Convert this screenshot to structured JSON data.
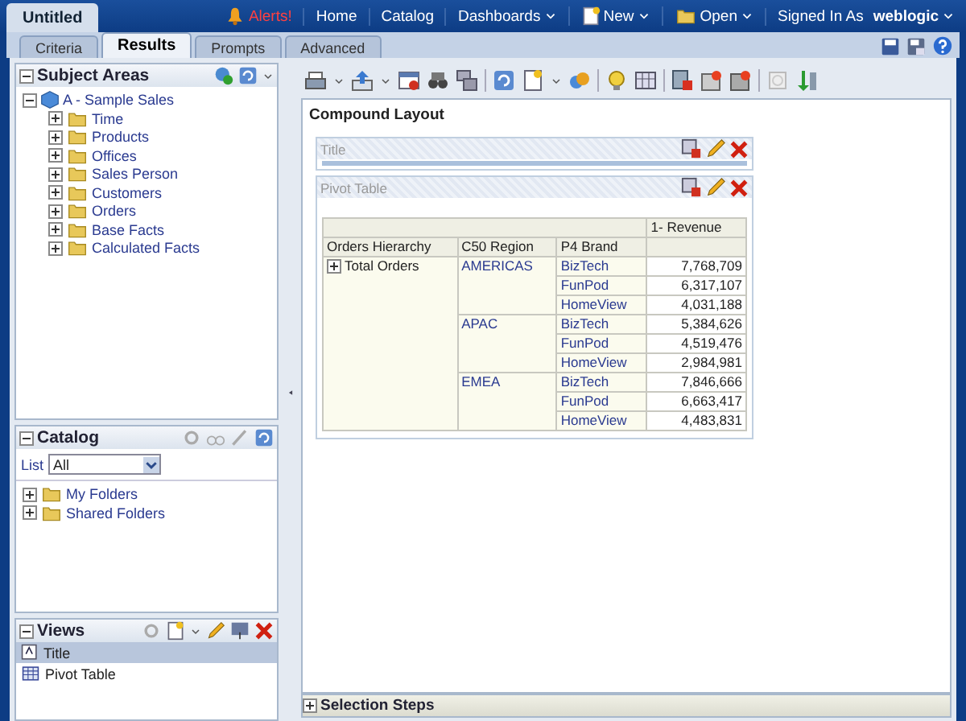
{
  "header": {
    "doc_title": "Untitled",
    "alerts": "Alerts!",
    "nav": [
      {
        "label": "Home",
        "menu": false
      },
      {
        "label": "Catalog",
        "menu": false
      },
      {
        "label": "Dashboards",
        "menu": true
      },
      {
        "label": "New",
        "menu": true
      },
      {
        "label": "Open",
        "menu": true
      }
    ],
    "signed_in_label": "Signed In As",
    "user": "weblogic"
  },
  "tabs": [
    {
      "label": "Criteria",
      "selected": false
    },
    {
      "label": "Results",
      "selected": true
    },
    {
      "label": "Prompts",
      "selected": false
    },
    {
      "label": "Advanced",
      "selected": false
    }
  ],
  "subject_areas": {
    "title": "Subject Areas",
    "root": {
      "label": "A - Sample Sales",
      "expanded": true,
      "children": [
        {
          "label": "Time",
          "expanded": false
        },
        {
          "label": "Products",
          "expanded": false
        },
        {
          "label": "Offices",
          "expanded": false
        },
        {
          "label": "Sales Person",
          "expanded": false
        },
        {
          "label": "Customers",
          "expanded": false
        },
        {
          "label": "Orders",
          "expanded": false
        },
        {
          "label": "Base Facts",
          "expanded": false
        },
        {
          "label": "Calculated Facts",
          "expanded": false
        }
      ]
    }
  },
  "catalog": {
    "title": "Catalog",
    "list_label": "List",
    "list_value": "All",
    "items": [
      {
        "label": "My Folders",
        "expanded": false
      },
      {
        "label": "Shared Folders",
        "expanded": false
      }
    ]
  },
  "views": {
    "title": "Views",
    "items": [
      {
        "label": "Title",
        "kind": "title",
        "selected": true
      },
      {
        "label": "Pivot Table",
        "kind": "pivot",
        "selected": false
      }
    ]
  },
  "compound_layout": {
    "title": "Compound Layout",
    "views": [
      {
        "title": "Title",
        "kind": "title"
      },
      {
        "title": "Pivot Table",
        "kind": "pivot"
      }
    ]
  },
  "pivot": {
    "measure": "1- Revenue",
    "columns": [
      "Orders Hierarchy",
      "C50 Region",
      "P4 Brand"
    ],
    "hierarchy": "Total Orders",
    "hierarchy_expanded": false,
    "regions": [
      {
        "name": "AMERICAS",
        "rows": [
          {
            "brand": "BizTech",
            "value": "7,768,709"
          },
          {
            "brand": "FunPod",
            "value": "6,317,107"
          },
          {
            "brand": "HomeView",
            "value": "4,031,188"
          }
        ]
      },
      {
        "name": "APAC",
        "rows": [
          {
            "brand": "BizTech",
            "value": "5,384,626"
          },
          {
            "brand": "FunPod",
            "value": "4,519,476"
          },
          {
            "brand": "HomeView",
            "value": "2,984,981"
          }
        ]
      },
      {
        "name": "EMEA",
        "rows": [
          {
            "brand": "BizTech",
            "value": "7,846,666"
          },
          {
            "brand": "FunPod",
            "value": "6,663,417"
          },
          {
            "brand": "HomeView",
            "value": "4,483,831"
          }
        ]
      }
    ]
  },
  "selection_steps": {
    "title": "Selection Steps",
    "expanded": false
  }
}
